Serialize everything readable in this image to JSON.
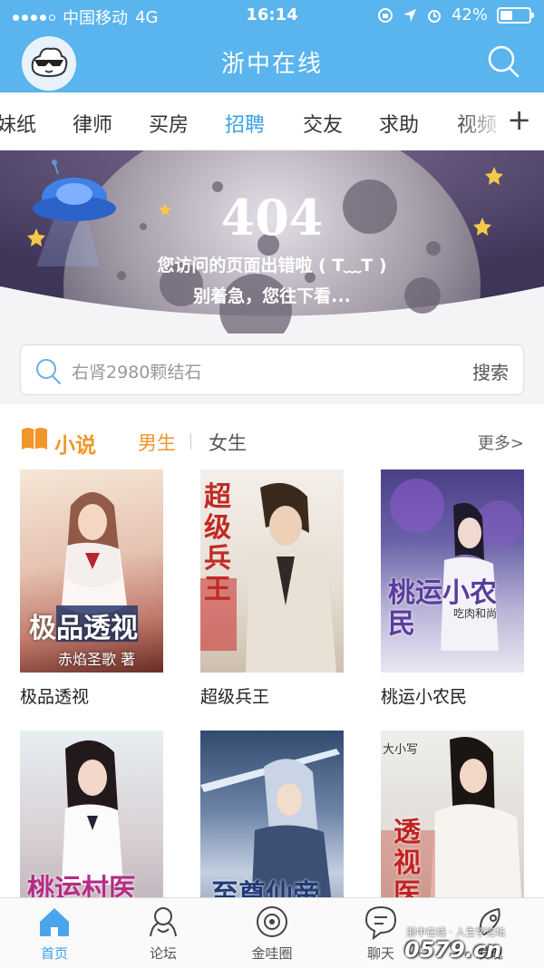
{
  "status_bar": {
    "carrier": "中国移动",
    "network": "4G",
    "time": "16:14",
    "battery": "42%",
    "battery_level": 0.42
  },
  "header": {
    "title": "浙中在线"
  },
  "categories": [
    "妹纸",
    "律师",
    "买房",
    "招聘",
    "交友",
    "求助",
    "视频"
  ],
  "active_category": "招聘",
  "error_banner": {
    "code": "404",
    "message": "您访问的页面出错啦 ( T﹏T )",
    "hint": "别着急，您往下看..."
  },
  "search": {
    "placeholder": "右肾2980颗结石",
    "button": "搜索"
  },
  "novel_section": {
    "title": "小说",
    "tabs": [
      "男生",
      "女生"
    ],
    "active_tab": "男生",
    "more": "更多>",
    "books": [
      {
        "name": "极品透视",
        "cover_title": "极品透视",
        "cover_author": "赤焰圣歌 著"
      },
      {
        "name": "超级兵王",
        "cover_title": "超级兵王",
        "cover_author": ""
      },
      {
        "name": "桃运小农民",
        "cover_title": "桃运小农民",
        "cover_author": "吃肉和尚"
      },
      {
        "name": "",
        "cover_title": "桃运村医",
        "cover_author": ""
      },
      {
        "name": "",
        "cover_title": "至尊仙帝",
        "cover_author": ""
      },
      {
        "name": "",
        "cover_title": "透视医",
        "cover_author": "大小写"
      }
    ]
  },
  "tab_bar": [
    {
      "label": "首页",
      "icon": "home-icon",
      "active": true
    },
    {
      "label": "论坛",
      "icon": "forum-icon",
      "active": false
    },
    {
      "label": "金哇圈",
      "icon": "circle-icon",
      "active": false
    },
    {
      "label": "聊天",
      "icon": "chat-icon",
      "active": false
    },
    {
      "label": "发现",
      "icon": "discover-icon",
      "active": false
    }
  ],
  "watermark": {
    "line1": "浙中在线 · 人生学论坛",
    "line2": "0579.cn"
  },
  "colors": {
    "header": "#5ab4ee",
    "accent": "#3aa0e8",
    "orange": "#f0962a"
  }
}
